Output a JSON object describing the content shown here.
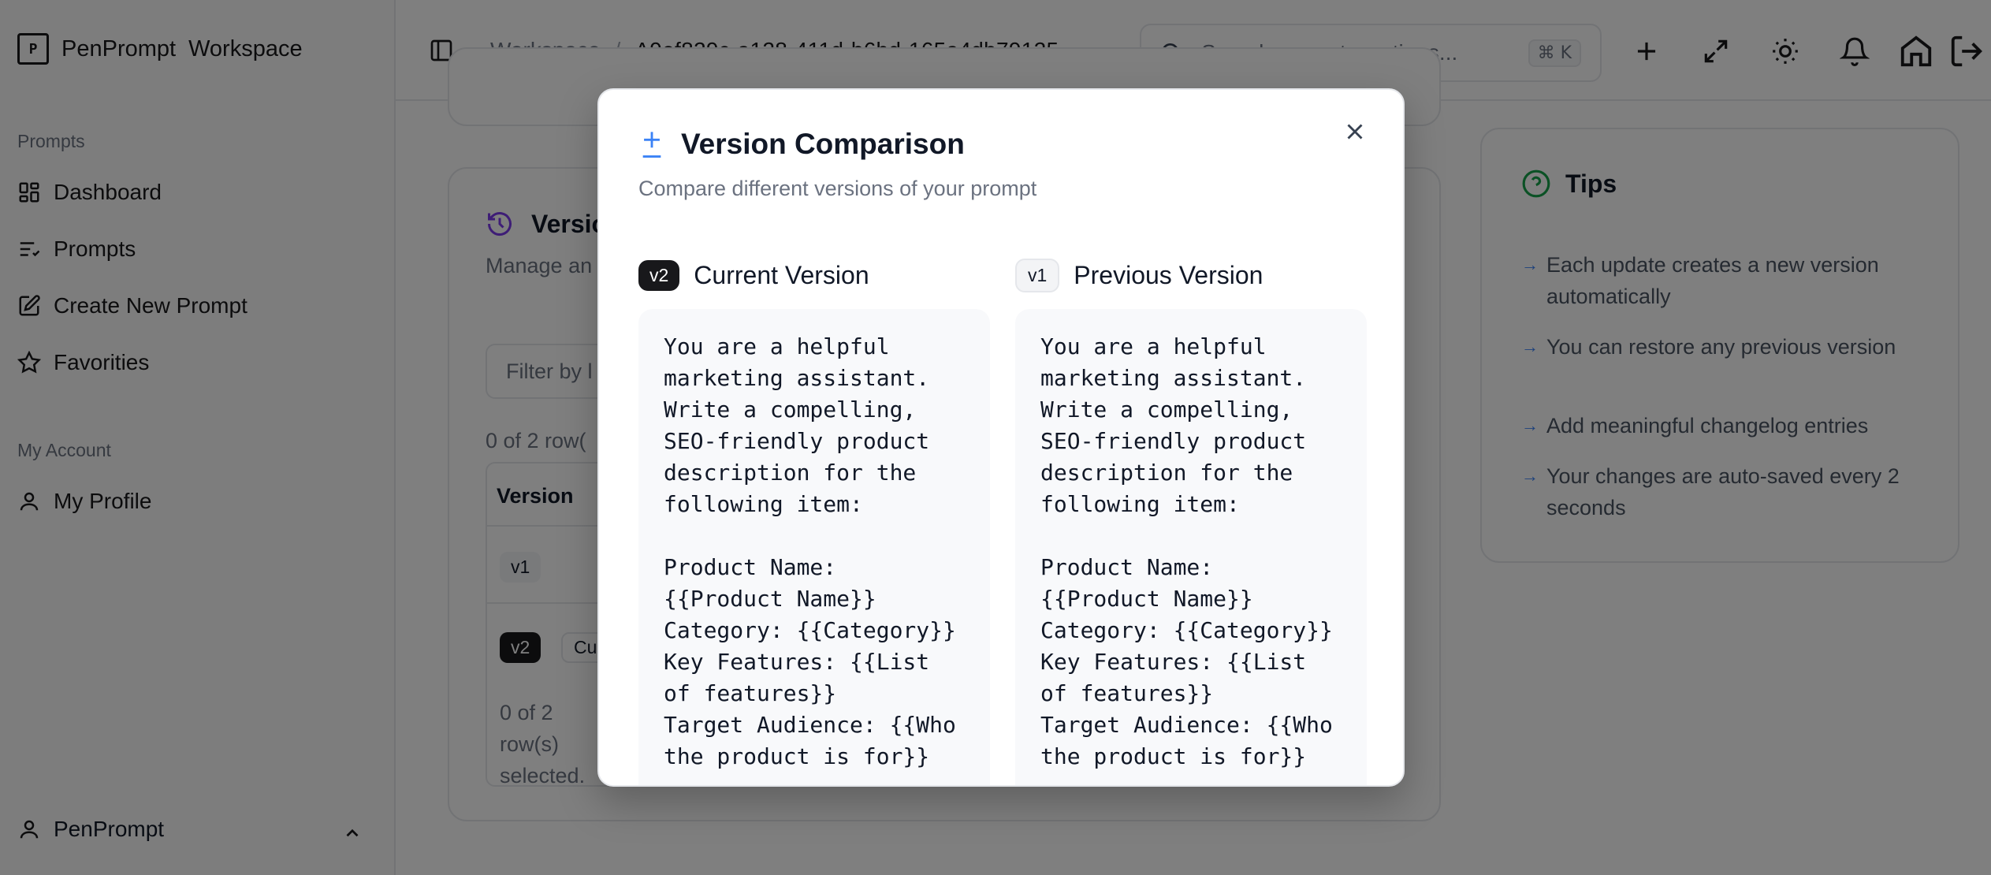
{
  "brand": {
    "name": "PenPrompt",
    "workspace": "Workspace"
  },
  "sidebar": {
    "section_prompts": "Prompts",
    "items": [
      {
        "label": "Dashboard",
        "icon": "dashboard-icon"
      },
      {
        "label": "Prompts",
        "icon": "list-icon"
      },
      {
        "label": "Create New Prompt",
        "icon": "edit-icon"
      },
      {
        "label": "Favorities",
        "icon": "star-icon"
      }
    ],
    "section_account": "My Account",
    "account_items": [
      {
        "label": "My Profile",
        "icon": "user-icon"
      }
    ],
    "footer_user": "PenPrompt"
  },
  "header": {
    "breadcrumb": [
      "Workspace",
      "A9ef829c-a128-411d-b6bd-165a4db79125"
    ],
    "breadcrumb_sep": "/",
    "search_placeholder": "Search prompts, actions...",
    "search_shortcut": "⌘ K"
  },
  "background": {
    "versions_title": "Versio",
    "versions_subtitle": "Manage an",
    "filter_placeholder": "Filter by l",
    "rows_selected_top": "0 of 2 row(",
    "col_version": "Version",
    "row_v1": "v1",
    "row_v2": "v2",
    "row_v2_tag": "Cu",
    "rows_selected_footer": [
      "0 of 2",
      "row(s)",
      "selected."
    ]
  },
  "tips": {
    "title": "Tips",
    "items": [
      "Each update creates a new version automatically",
      "You can restore any previous version",
      "Add meaningful changelog entries",
      "Your changes are auto-saved every 2 seconds"
    ]
  },
  "modal": {
    "title": "Version Comparison",
    "subtitle": "Compare different versions of your prompt",
    "current": {
      "badge": "v2",
      "label": "Current Version",
      "content": "You are a helpful marketing assistant. Write a compelling, SEO-friendly product description for the following item:\n\nProduct Name: {{Product Name}}\nCategory: {{Category}}\nKey Features: {{List of features}}\nTarget Audience: {{Who the product is for}}"
    },
    "previous": {
      "badge": "v1",
      "label": "Previous Version",
      "content": "You are a helpful marketing assistant. Write a compelling, SEO-friendly product description for the following item:\n\nProduct Name: {{Product Name}}\nCategory: {{Category}}\nKey Features: {{List of features}}\nTarget Audience: {{Who the product is for}}"
    }
  },
  "colors": {
    "accent": "#3b82f6",
    "tips_icon": "#16a34a",
    "history_icon": "#7c3aed",
    "dark_badge": "#18181b"
  }
}
